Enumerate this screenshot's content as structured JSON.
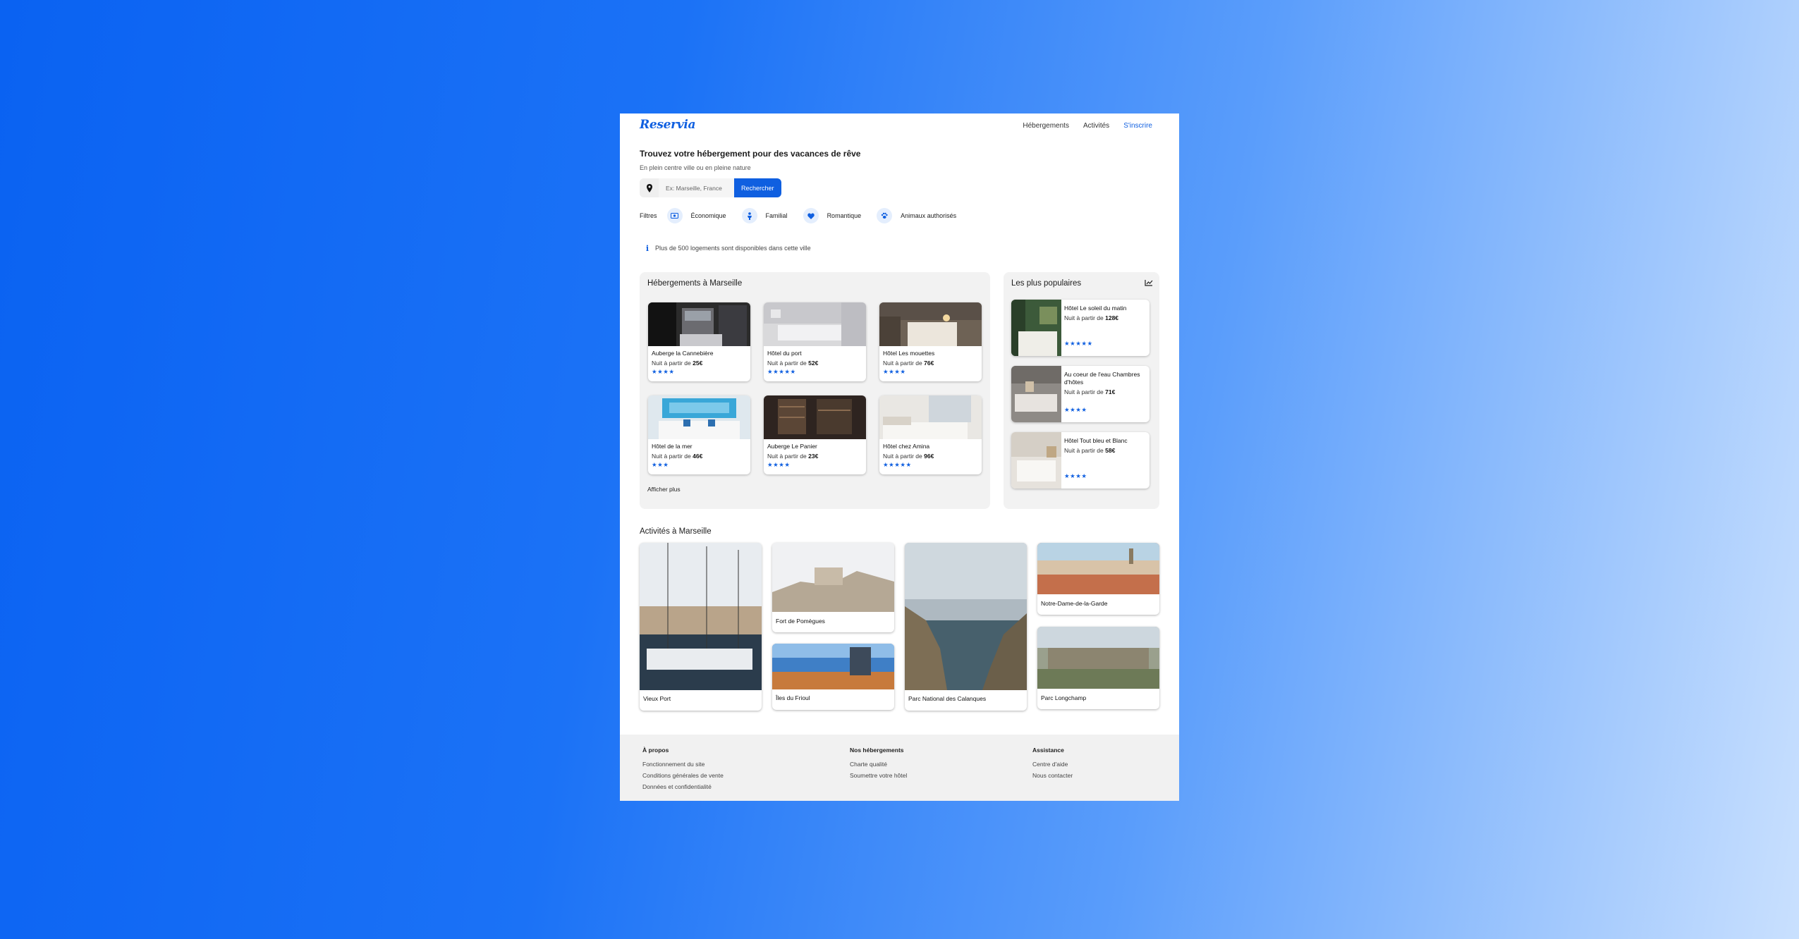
{
  "brand": {
    "logo": "Reservia",
    "accent": "#0f5fe0"
  },
  "nav": {
    "items": [
      "Hébergements",
      "Activités"
    ],
    "signup": "S'inscrire"
  },
  "hero": {
    "title": "Trouvez votre hébergement pour des vacances de rêve",
    "subtitle": "En plein centre ville ou en pleine nature",
    "search_placeholder": "Ex: Marseille, France",
    "search_button": "Rechercher",
    "location_icon": "map-pin-icon"
  },
  "filters": {
    "label": "Filtres",
    "items": [
      {
        "label": "Économique",
        "icon": "money-icon"
      },
      {
        "label": "Familial",
        "icon": "family-icon"
      },
      {
        "label": "Romantique",
        "icon": "heart-icon"
      },
      {
        "label": "Animaux authorisés",
        "icon": "paw-icon"
      }
    ]
  },
  "info": {
    "text": "Plus de 500 logements sont disponibles dans cette ville",
    "icon": "info-icon"
  },
  "hotels": {
    "title": "Hébergements à Marseille",
    "price_prefix": "Nuit à partir de",
    "more": "Afficher plus",
    "items": [
      {
        "name": "Auberge la Cannebière",
        "price": "25€",
        "stars": "★★★★",
        "rating": 4
      },
      {
        "name": "Hôtel du port",
        "price": "52€",
        "stars": "★★★★★",
        "rating": 5
      },
      {
        "name": "Hôtel Les mouettes",
        "price": "76€",
        "stars": "★★★★",
        "rating": 4
      },
      {
        "name": "Hôtel de la mer",
        "price": "46€",
        "stars": "★★★",
        "rating": 3
      },
      {
        "name": "Auberge Le Panier",
        "price": "23€",
        "stars": "★★★★",
        "rating": 4
      },
      {
        "name": "Hôtel chez Amina",
        "price": "96€",
        "stars": "★★★★★",
        "rating": 5
      }
    ]
  },
  "popular": {
    "title": "Les plus populaires",
    "icon": "trending-chart-icon",
    "items": [
      {
        "name": "Hôtel Le soleil du matin",
        "price": "128€",
        "stars": "★★★★★",
        "rating": 5
      },
      {
        "name": "Au coeur de l'eau Chambres d'hôtes",
        "price": "71€",
        "stars": "★★★★",
        "rating": 4
      },
      {
        "name": "Hôtel Tout bleu et Blanc",
        "price": "58€",
        "stars": "★★★★",
        "rating": 4
      }
    ]
  },
  "activities": {
    "title": "Activités à Marseille",
    "items": [
      "Vieux Port",
      "Fort de Pomègues",
      "Îles du Frioul",
      "Parc National des Calanques",
      "Notre-Dame-de-la-Garde",
      "Parc Longchamp"
    ]
  },
  "footer": {
    "columns": [
      {
        "title": "À propos",
        "links": [
          "Fonctionnement du site",
          "Conditions générales de vente",
          "Données et confidentialité"
        ]
      },
      {
        "title": "Nos hébergements",
        "links": [
          "Charte qualité",
          "Soumettre votre hôtel"
        ]
      },
      {
        "title": "Assistance",
        "links": [
          "Centre d'aide",
          "Nous contacter"
        ]
      }
    ]
  }
}
